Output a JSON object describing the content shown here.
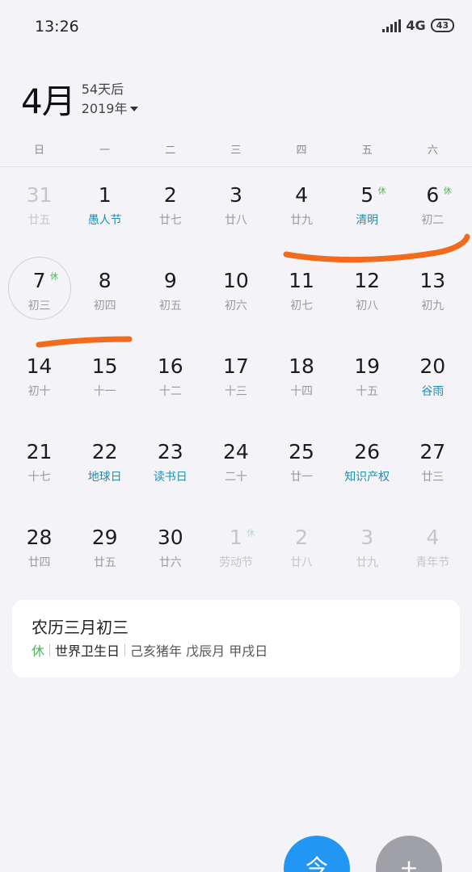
{
  "status": {
    "time": "13:26",
    "network": "4G",
    "network_suffix": "..ıl",
    "battery": "43"
  },
  "header": {
    "month": "4月",
    "days_until": "54天后",
    "year": "2019年"
  },
  "weekdays": [
    "日",
    "一",
    "二",
    "三",
    "四",
    "五",
    "六"
  ],
  "weeks": [
    [
      {
        "num": "31",
        "sub": "廿五",
        "other": true
      },
      {
        "num": "1",
        "sub": "愚人节",
        "festival": true
      },
      {
        "num": "2",
        "sub": "廿七"
      },
      {
        "num": "3",
        "sub": "廿八"
      },
      {
        "num": "4",
        "sub": "廿九"
      },
      {
        "num": "5",
        "sub": "清明",
        "festival": true,
        "badge": "休"
      },
      {
        "num": "6",
        "sub": "初二",
        "badge": "休"
      }
    ],
    [
      {
        "num": "7",
        "sub": "初三",
        "badge": "休",
        "selected": true
      },
      {
        "num": "8",
        "sub": "初四"
      },
      {
        "num": "9",
        "sub": "初五"
      },
      {
        "num": "10",
        "sub": "初六"
      },
      {
        "num": "11",
        "sub": "初七"
      },
      {
        "num": "12",
        "sub": "初八"
      },
      {
        "num": "13",
        "sub": "初九"
      }
    ],
    [
      {
        "num": "14",
        "sub": "初十"
      },
      {
        "num": "15",
        "sub": "十一"
      },
      {
        "num": "16",
        "sub": "十二"
      },
      {
        "num": "17",
        "sub": "十三"
      },
      {
        "num": "18",
        "sub": "十四"
      },
      {
        "num": "19",
        "sub": "十五"
      },
      {
        "num": "20",
        "sub": "谷雨",
        "festival": true
      }
    ],
    [
      {
        "num": "21",
        "sub": "十七"
      },
      {
        "num": "22",
        "sub": "地球日",
        "festival": true
      },
      {
        "num": "23",
        "sub": "读书日",
        "festival": true
      },
      {
        "num": "24",
        "sub": "二十"
      },
      {
        "num": "25",
        "sub": "廿一"
      },
      {
        "num": "26",
        "sub": "知识产权",
        "festival": true
      },
      {
        "num": "27",
        "sub": "廿三"
      }
    ],
    [
      {
        "num": "28",
        "sub": "廿四"
      },
      {
        "num": "29",
        "sub": "廿五"
      },
      {
        "num": "30",
        "sub": "廿六"
      },
      {
        "num": "1",
        "sub": "劳动节",
        "other": true,
        "badge": "休"
      },
      {
        "num": "2",
        "sub": "廿八",
        "other": true
      },
      {
        "num": "3",
        "sub": "廿九",
        "other": true
      },
      {
        "num": "4",
        "sub": "青年节",
        "other": true
      }
    ]
  ],
  "info": {
    "title": "农历三月初三",
    "rest": "休",
    "event": "世界卫生日",
    "ganzhi": "己亥猪年 戊辰月 甲戌日"
  },
  "colors": {
    "festival": "#1e8fb4",
    "rest_badge": "#4fb35a",
    "annotation": "#f26a1b",
    "fab_primary": "#2196f3",
    "fab_secondary": "#a0a1a6"
  },
  "fab": {
    "primary_glyph": "今",
    "secondary_glyph": "+"
  }
}
